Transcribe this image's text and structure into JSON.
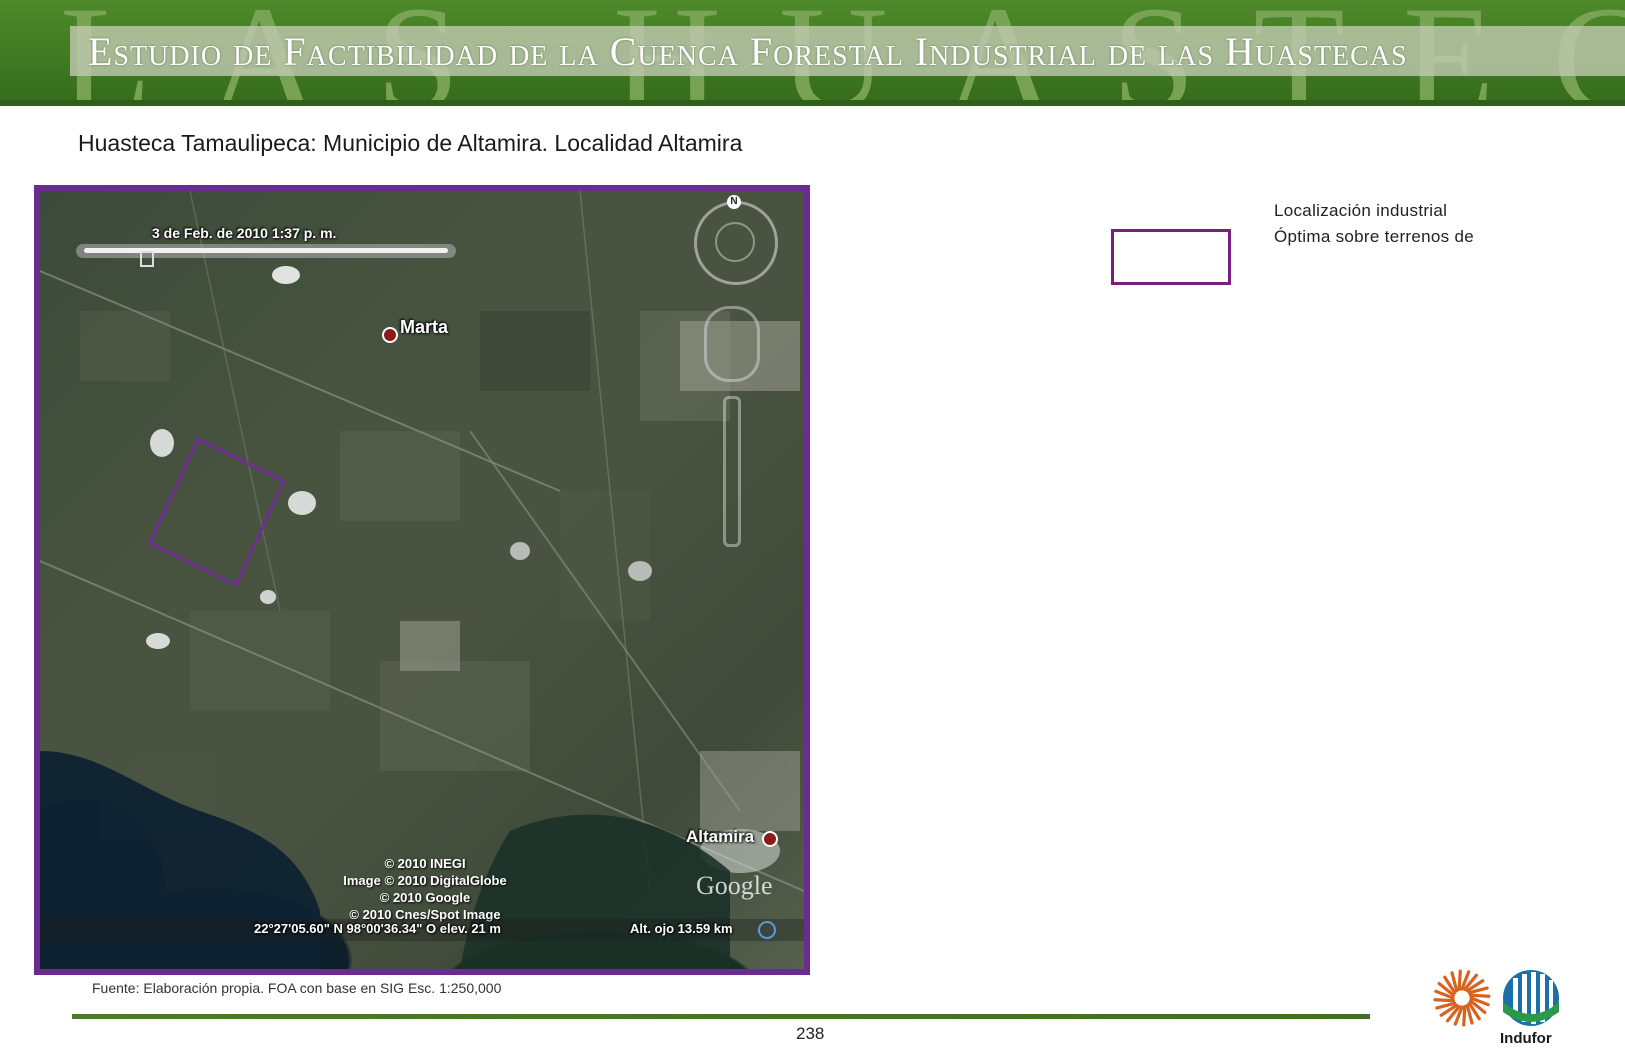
{
  "header": {
    "title": "Estudio de Factibilidad de la Cuenca Forestal Industrial de las Huastecas",
    "background_word": "LAS HUASTECAS"
  },
  "page_title": "Huasteca  Tamaulipeca: Municipio de Altamira. Localidad Altamira",
  "map": {
    "date": "3 de Feb. de 2010   1:37 p. m.",
    "places": {
      "marta": "Marta",
      "altamira": "Altamira"
    },
    "credits": [
      "© 2010 INEGI",
      "Image © 2010 DigitalGlobe",
      "© 2010 Google",
      "© 2010 Cnes/Spot Image"
    ],
    "coordinates": "22°27'05.60\" N     98°00'36.34\" O    elev.   21 m",
    "eye_altitude": "Alt. ojo    13.59 km",
    "logo": "Google",
    "compass": "N"
  },
  "legend": {
    "line1": "Localización industrial",
    "line2": "Óptima sobre terrenos de"
  },
  "source": "Fuente: Elaboración propia. FOA con base en SIG Esc. 1:250,000",
  "page_number": "238",
  "logos": {
    "indufor": "Indufor"
  },
  "colors": {
    "header_green": "#3f7a22",
    "frame_purple": "#6a2c91",
    "legend_purple": "#7a1f7e",
    "logo_orange": "#d8621e",
    "logo_blue": "#1d6fa8"
  }
}
